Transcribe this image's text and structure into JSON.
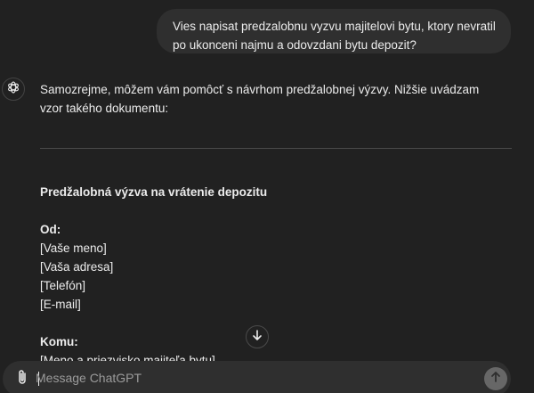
{
  "conversation": {
    "user_message": "Vies napisat predzalobnu vyzvu majitelovi bytu, ktory nevratil po ukonceni najmu a odovzdani bytu depozit?",
    "assistant_intro": "Samozrejme, môžem vám pomôcť s návrhom predžalobnej výzvy. Nižšie uvádzam vzor takého dokumentu:",
    "document": {
      "title": "Predžalobná výzva na vrátenie depozitu",
      "from_label": "Od:",
      "from_lines": [
        "[Vaše meno]",
        "[Vaša adresa]",
        "[Telefón]",
        "[E-mail]"
      ],
      "to_label": "Komu:",
      "to_lines": [
        "[Meno a priezvisko majiteľa bytu]"
      ]
    }
  },
  "composer": {
    "placeholder": "Message ChatGPT"
  },
  "icons": {
    "avatar": "openai-logo-icon",
    "scroll": "arrow-down-icon",
    "attach": "paperclip-icon",
    "send": "arrow-up-icon"
  },
  "colors": {
    "background": "#212121",
    "bubble": "#2f2f2f",
    "text": "#ececec",
    "send_button": "#676767"
  }
}
